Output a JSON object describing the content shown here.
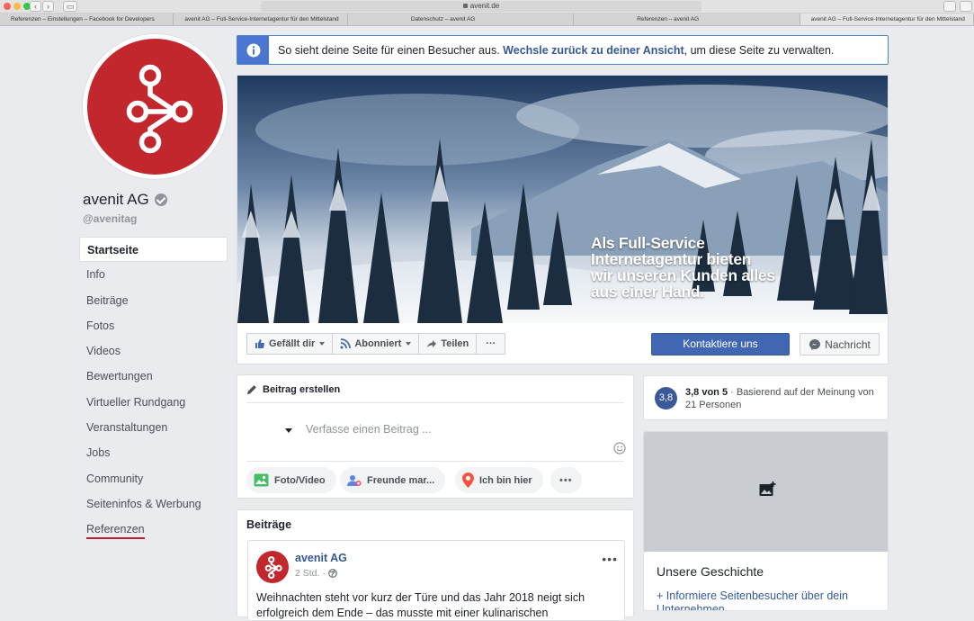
{
  "browser": {
    "url": "avenit.de",
    "tabs": [
      "Referenzen – Einstellungen – Facebook for Developers",
      "avenit AG – Full-Service-Internetagentur für den Mittelstand",
      "Datenschutz – avenit AG",
      "Referenzen – avenit AG",
      "avenit AG – Full-Service-Internetagentur für den Mittelstand"
    ]
  },
  "notice": {
    "text_before": "So sieht deine Seite für einen Besucher aus. ",
    "link": "Wechsle zurück zu deiner Ansicht",
    "text_after": ", um diese Seite zu verwalten."
  },
  "page": {
    "name": "avenit AG",
    "handle": "@avenitag",
    "brand_color": "#c1272d"
  },
  "nav": {
    "items": [
      "Startseite",
      "Info",
      "Beiträge",
      "Fotos",
      "Videos",
      "Bewertungen",
      "Virtueller Rundgang",
      "Veranstaltungen",
      "Jobs",
      "Community",
      "Seiteninfos & Werbung",
      "Referenzen"
    ]
  },
  "cover": {
    "text": [
      "Als Full-Service",
      "Internetagentur bieten",
      "wir unseren Kunden alles",
      "aus einer Hand."
    ]
  },
  "actions": {
    "like": "Gefällt dir",
    "follow": "Abonniert",
    "share": "Teilen",
    "more": "···",
    "contact": "Kontaktiere uns",
    "message": "Nachricht"
  },
  "create_post": {
    "title": "Beitrag erstellen",
    "placeholder": "Verfasse einen Beitrag ...",
    "photo": "Foto/Video",
    "tag": "Freunde mar...",
    "checkin": "Ich bin hier",
    "more": "•••"
  },
  "rating": {
    "badge": "3,8",
    "score": "3,8 von 5",
    "detail": " · Basierend auf der Meinung von 21 Personen"
  },
  "story": {
    "title": "Unsere Geschichte",
    "link": "+ Informiere Seitenbesucher über dein Unternehmen"
  },
  "posts": {
    "title": "Beiträge",
    "author": "avenit AG",
    "time": "2 Std. ·",
    "text": "Weihnachten steht vor kurz der Türe und das Jahr 2018 neigt sich erfolgreich dem Ende – das musste mit einer kulinarischen",
    "dots": "•••"
  },
  "colors": {
    "facebook_blue": "#4267b2",
    "link_blue": "#365899",
    "background": "#e9ebee"
  }
}
